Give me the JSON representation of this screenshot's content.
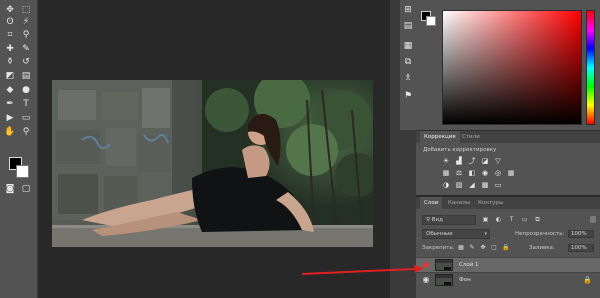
{
  "tools": [
    {
      "icon": "move-tool-icon",
      "glyph": "✥"
    },
    {
      "icon": "marquee-tool-icon",
      "glyph": "⬚"
    },
    {
      "icon": "lasso-tool-icon",
      "glyph": "ʘ"
    },
    {
      "icon": "magic-wand-tool-icon",
      "glyph": "⚡"
    },
    {
      "icon": "crop-tool-icon",
      "glyph": "⌗"
    },
    {
      "icon": "eyedropper-tool-icon",
      "glyph": "⚲"
    },
    {
      "icon": "healing-brush-tool-icon",
      "glyph": "✚"
    },
    {
      "icon": "brush-tool-icon",
      "glyph": "✎"
    },
    {
      "icon": "clone-stamp-tool-icon",
      "glyph": "⚱"
    },
    {
      "icon": "history-brush-tool-icon",
      "glyph": "↺"
    },
    {
      "icon": "eraser-tool-icon",
      "glyph": "◩"
    },
    {
      "icon": "gradient-tool-icon",
      "glyph": "▤"
    },
    {
      "icon": "blur-tool-icon",
      "glyph": "◆"
    },
    {
      "icon": "dodge-tool-icon",
      "glyph": "●"
    },
    {
      "icon": "pen-tool-icon",
      "glyph": "✒"
    },
    {
      "icon": "type-tool-icon",
      "glyph": "T"
    },
    {
      "icon": "path-selection-tool-icon",
      "glyph": "▶"
    },
    {
      "icon": "shape-tool-icon",
      "glyph": "▭"
    },
    {
      "icon": "hand-tool-icon",
      "glyph": "✋"
    },
    {
      "icon": "zoom-tool-icon",
      "glyph": "⚲"
    }
  ],
  "tools_bottom": [
    {
      "icon": "quick-mask-icon",
      "glyph": "◙"
    },
    {
      "icon": "screen-mode-icon",
      "glyph": "▢"
    }
  ],
  "right_icons": [
    {
      "icon": "history-panel-icon",
      "glyph": "⊞"
    },
    {
      "icon": "properties-panel-icon",
      "glyph": "▤"
    },
    {
      "icon": "brush-presets-icon",
      "glyph": "▦"
    },
    {
      "icon": "clone-source-icon",
      "glyph": "⧉"
    },
    {
      "icon": "actions-panel-icon",
      "glyph": "♗"
    },
    {
      "icon": "info-panel-icon",
      "glyph": "⚑"
    }
  ],
  "adjustments": {
    "tabs": [
      "Коррекция",
      "Стили"
    ],
    "hint": "Добавить корректировку"
  },
  "layers": {
    "tabs": [
      "Слои",
      "Каналы",
      "Контуры"
    ],
    "filter_label": "Вид",
    "blend_mode": "Обычные",
    "opacity_label": "Непрозрачность:",
    "opacity_value": "100%",
    "lock_label": "Закрепить:",
    "fill_label": "Заливка:",
    "fill_value": "100%",
    "items": [
      {
        "name": "Слой 1",
        "selected": true,
        "eye_highlight": true
      },
      {
        "name": "Фон",
        "selected": false,
        "eye_highlight": false,
        "locked": true
      }
    ]
  },
  "colors": {
    "annotation_arrow": "#e02020",
    "panel_bg": "#535353",
    "workspace_bg": "#282828"
  }
}
